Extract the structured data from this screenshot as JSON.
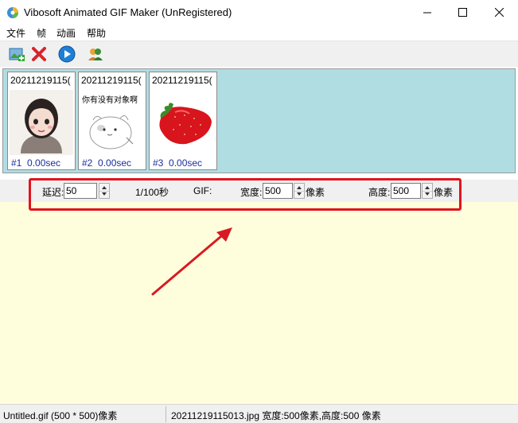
{
  "window": {
    "title": "Vibosoft Animated GIF Maker (UnRegistered)"
  },
  "menu": {
    "items": [
      "文件",
      "帧",
      "动画",
      "帮助"
    ]
  },
  "toolbar": {
    "buttons": [
      "add-frames-icon",
      "delete-icon",
      "play-icon",
      "users-icon"
    ]
  },
  "frames": [
    {
      "name": "20211219115(",
      "index": "#1",
      "delay": "0.00sec"
    },
    {
      "name": "20211219115(",
      "index": "#2",
      "delay": "0.00sec",
      "thumb_text": "你有没有对象啊"
    },
    {
      "name": "20211219115(",
      "index": "#3",
      "delay": "0.00sec"
    }
  ],
  "settings": {
    "delay_label": "延迟:",
    "delay_value": "50",
    "delay_unit": "1/100秒",
    "gif_label": "GIF:",
    "width_label": "宽度:",
    "width_value": "500",
    "width_unit": "像素",
    "height_label": "高度:",
    "height_value": "500",
    "height_unit": "像素"
  },
  "status": {
    "left": "Untitled.gif (500 * 500)像素",
    "right": "20211219115013.jpg 宽度:500像素,高度:500 像素"
  },
  "colors": {
    "frames_bg": "#b0dde2",
    "canvas_bg": "#fffedc",
    "highlight": "#e0141c",
    "frame_label": "#1a2f9a"
  }
}
